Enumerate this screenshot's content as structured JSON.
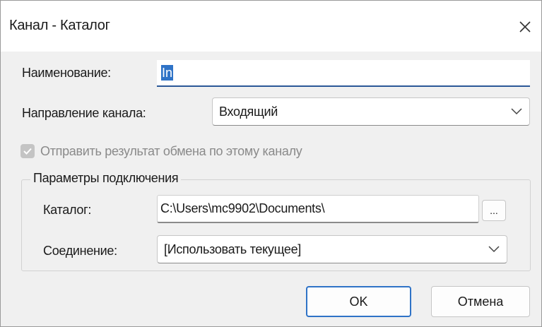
{
  "window": {
    "title": "Канал - Каталог"
  },
  "form": {
    "name_label": "Наименование:",
    "name_value": "In",
    "direction_label": "Направление канала:",
    "direction_value": "Входящий",
    "send_result_label": "Отправить результат обмена по этому каналу",
    "send_result_checked": true,
    "send_result_enabled": false
  },
  "connection": {
    "group_title": "Параметры подключения",
    "catalog_label": "Каталог:",
    "catalog_value": "C:\\Users\\mc9902\\Documents\\",
    "browse_label": "...",
    "connection_label": "Соединение:",
    "connection_value": "[Использовать текущее]"
  },
  "buttons": {
    "ok_label": "OK",
    "cancel_label": "Отмена"
  },
  "icons": {
    "close": "close-icon",
    "dropdown": "chevron-down-icon",
    "check": "checkmark-icon"
  },
  "colors": {
    "accent": "#2f73c7",
    "dialog_bg": "#f0f0f0",
    "disabled_text": "#8a8a8a"
  }
}
